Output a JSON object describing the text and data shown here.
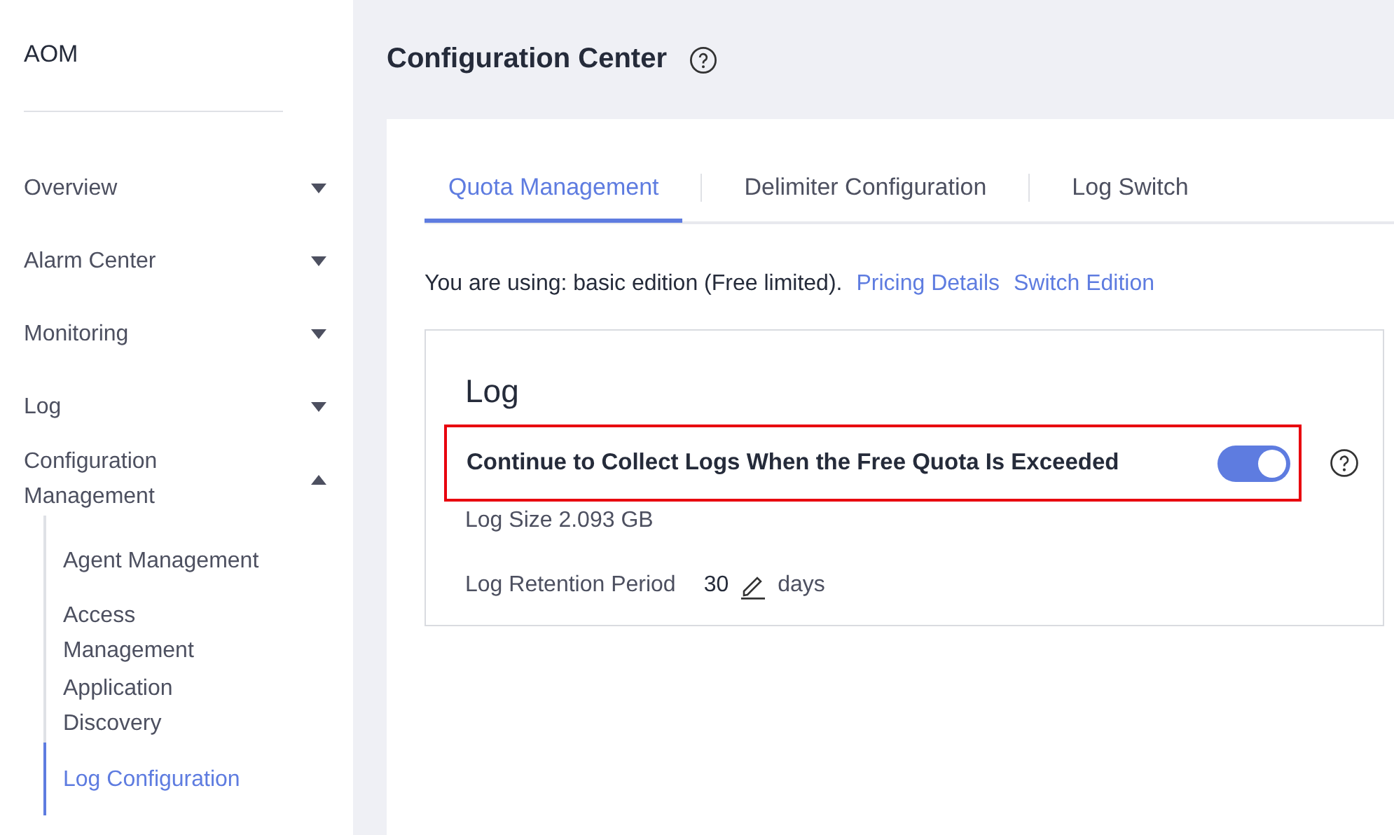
{
  "sidebar": {
    "title": "AOM",
    "items": [
      {
        "label": "Overview",
        "expanded": false
      },
      {
        "label": "Alarm Center",
        "expanded": false
      },
      {
        "label": "Monitoring",
        "expanded": false
      },
      {
        "label": "Log",
        "expanded": false
      },
      {
        "label": "Configuration Management",
        "expanded": true,
        "children": [
          {
            "label": "Agent Management",
            "selected": false
          },
          {
            "label": "Access Management",
            "selected": false
          },
          {
            "label": "Application Discovery",
            "selected": false
          },
          {
            "label": "Log Configuration",
            "selected": true
          }
        ]
      }
    ]
  },
  "page": {
    "title": "Configuration Center"
  },
  "tabs": [
    {
      "label": "Quota Management",
      "selected": true
    },
    {
      "label": "Delimiter Configuration",
      "selected": false
    },
    {
      "label": "Log Switch",
      "selected": false
    }
  ],
  "edition": {
    "text": "You are using: basic edition (Free limited).",
    "links": [
      "Pricing Details",
      "Switch Edition"
    ]
  },
  "log_section": {
    "title": "Log",
    "setting": {
      "label": "Continue to Collect Logs When the Free Quota Is Exceeded",
      "on": true,
      "highlighted": true
    },
    "size": "Log Size 2.093 GB",
    "retention_label": "Log Retention Period",
    "retention_value": "30",
    "retention_unit": "days"
  }
}
